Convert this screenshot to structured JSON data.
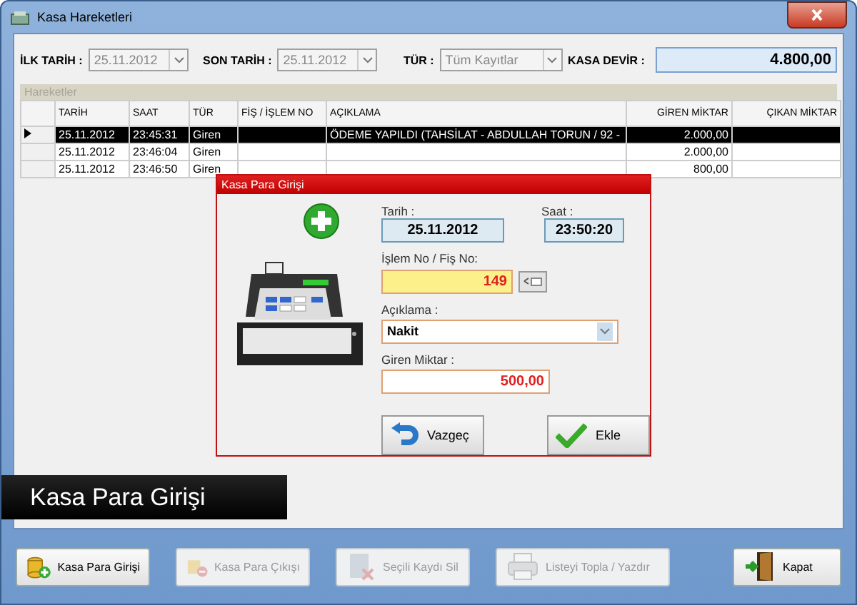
{
  "window": {
    "title": "Kasa Hareketleri"
  },
  "filters": {
    "start_label": "İLK TARİH :",
    "start_value": "25.11.2012",
    "end_label": "SON TARİH :",
    "end_value": "25.11.2012",
    "type_label": "TÜR :",
    "type_value": "Tüm Kayıtlar",
    "balance_label": "KASA DEVİR :",
    "balance_value": "4.800,00"
  },
  "grid": {
    "title": "Hareketler",
    "columns": [
      "TARİH",
      "SAAT",
      "TÜR",
      "FİŞ / İŞLEM NO",
      "AÇIKLAMA",
      "GİREN MİKTAR",
      "ÇIKAN MİKTAR"
    ],
    "rows": [
      {
        "selected": true,
        "cells": [
          "25.11.2012",
          "23:45:31",
          "Giren",
          "",
          "ÖDEME YAPILDI (TAHSİLAT - ABDULLAH TORUN / 92 -",
          "2.000,00",
          ""
        ]
      },
      {
        "selected": false,
        "cells": [
          "25.11.2012",
          "23:46:04",
          "Giren",
          "",
          "",
          "2.000,00",
          ""
        ]
      },
      {
        "selected": false,
        "cells": [
          "25.11.2012",
          "23:46:50",
          "Giren",
          "",
          "",
          "800,00",
          ""
        ]
      }
    ]
  },
  "dialog": {
    "title": "Kasa Para Girişi",
    "date_label": "Tarih :",
    "date_value": "25.11.2012",
    "time_label": "Saat :",
    "time_value": "23:50:20",
    "number_label": "İşlem No / Fiş No:",
    "number_value": "149",
    "description_label": "Açıklama :",
    "description_value": "Nakit",
    "amount_label": "Giren Miktar :",
    "amount_value": "500,00",
    "cancel": "Vazgeç",
    "add": "Ekle"
  },
  "caption": "Kasa Para Girişi",
  "buttons": [
    {
      "kind": "income",
      "label": "Kasa Para Girişi",
      "disabled": false
    },
    {
      "kind": "expense",
      "label": "Kasa Para Çıkışı",
      "disabled": true
    },
    {
      "kind": "delete",
      "label": "Seçili Kaydı Sil",
      "disabled": true
    },
    {
      "kind": "print",
      "label": "Listeyi Topla / Yazdır",
      "disabled": true
    },
    {
      "kind": "close",
      "label": "Kapat",
      "disabled": false
    }
  ]
}
